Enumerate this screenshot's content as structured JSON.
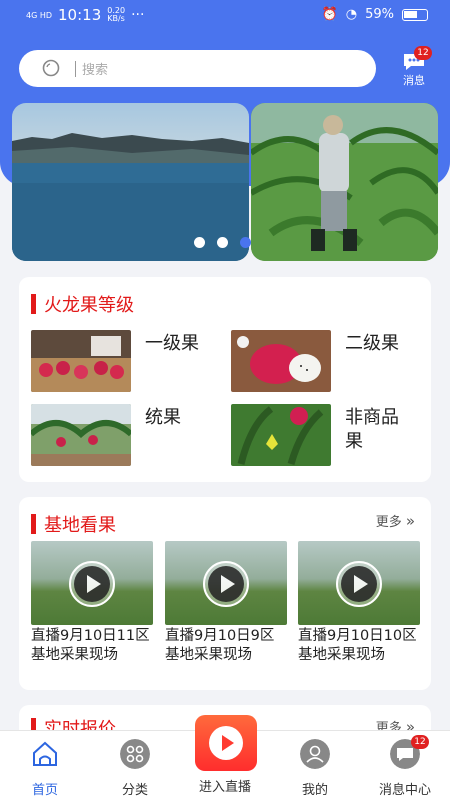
{
  "status_bar": {
    "signal": "4G HD",
    "time": "10:13",
    "rate": "0.20",
    "rate_unit": "KB/s",
    "dots": "···",
    "battery": "59%"
  },
  "search": {
    "placeholder": "搜索"
  },
  "header": {
    "messages_label": "消息",
    "messages_badge": "12"
  },
  "banner": {
    "slide_count": 3,
    "current_index": 2
  },
  "grades": {
    "title": "火龙果等级",
    "items": [
      {
        "label": "一级果"
      },
      {
        "label": "二级果"
      },
      {
        "label": "统果"
      },
      {
        "label": "非商品果"
      }
    ]
  },
  "base": {
    "title": "基地看果",
    "more": "更多",
    "videos": [
      {
        "caption": "直播9月10日11区基地采果现场"
      },
      {
        "caption": "直播9月10日9区基地采果现场"
      },
      {
        "caption": "直播9月10日10区基地采果现场"
      }
    ]
  },
  "price": {
    "title": "实时报价",
    "more": "更多"
  },
  "tabbar": {
    "home": "首页",
    "category": "分类",
    "live": "进入直播",
    "mine": "我的",
    "messages": "消息中心",
    "messages_badge": "12"
  },
  "colors": {
    "primary": "#4a74ee",
    "accent_red": "#e21a1a",
    "active_tab": "#2d66e0"
  }
}
